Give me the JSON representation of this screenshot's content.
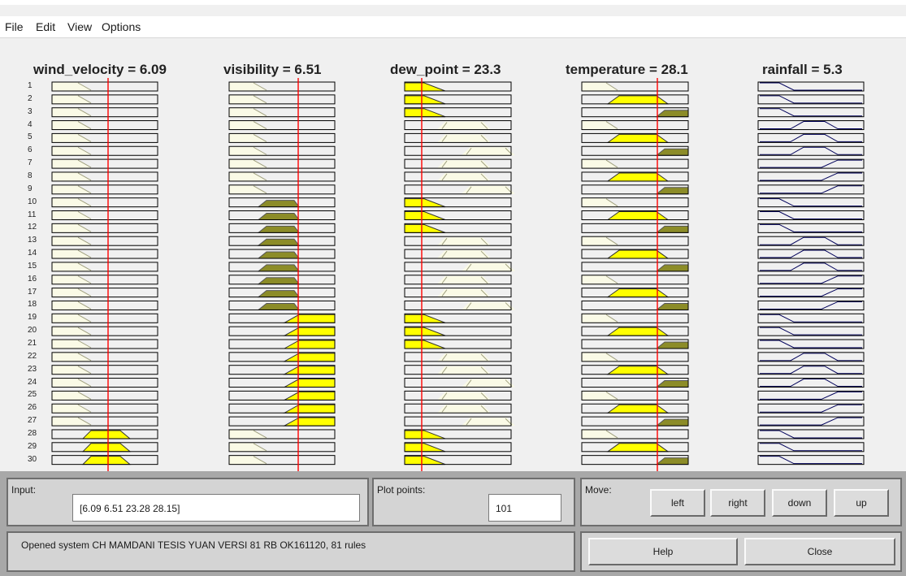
{
  "menu": {
    "file": "File",
    "edit": "Edit",
    "view": "View",
    "options": "Options"
  },
  "variables": [
    {
      "title": "wind_velocity = 6.09",
      "type": "input"
    },
    {
      "title": "visibility = 6.51",
      "type": "input"
    },
    {
      "title": "dew_point = 23.3",
      "type": "input"
    },
    {
      "title": "temperature = 28.1",
      "type": "input"
    },
    {
      "title": "rainfall = 5.3",
      "type": "output"
    }
  ],
  "rule_numbers": [
    "1",
    "2",
    "3",
    "4",
    "5",
    "6",
    "7",
    "8",
    "9",
    "10",
    "11",
    "12",
    "13",
    "14",
    "15",
    "16",
    "17",
    "18",
    "19",
    "20",
    "21",
    "22",
    "23",
    "24",
    "25",
    "26",
    "27",
    "28",
    "29",
    "30"
  ],
  "input_panel": {
    "label": "Input:",
    "value": "[6.09 6.51 23.28 28.15]"
  },
  "plot_points": {
    "label": "Plot points:",
    "value": "101"
  },
  "move_panel": {
    "label": "Move:",
    "left": "left",
    "right": "right",
    "down": "down",
    "up": "up"
  },
  "status": {
    "text": "Opened system CH MAMDANI TESIS YUAN VERSI 81 RB OK161120, 81 rules"
  },
  "buttons": {
    "help": "Help",
    "close": "Close"
  },
  "colors": {
    "fired_fill": "#ffff00",
    "partial_fill": "#8c8c28",
    "input_line": "#ff0000",
    "mf_outline": "#000000",
    "output_mf_stroke": "#00005a",
    "faint_fill": "#fafae6"
  }
}
